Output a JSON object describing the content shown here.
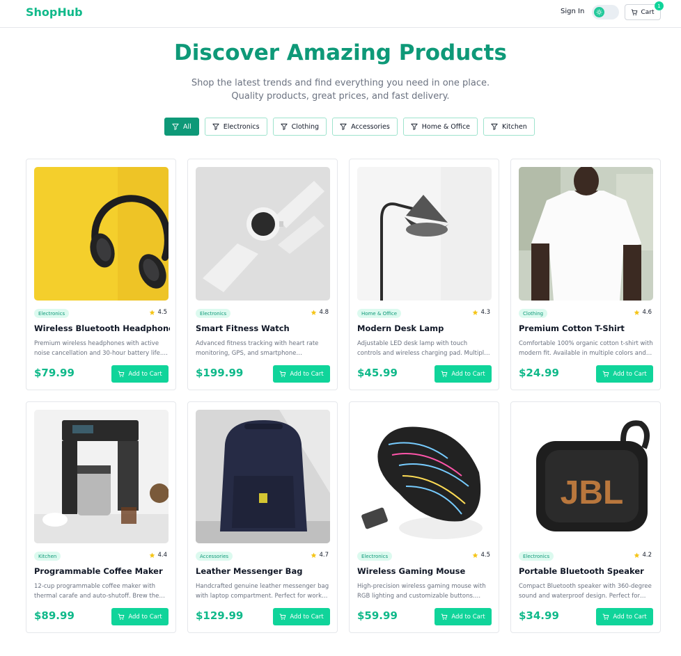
{
  "header": {
    "brand": "ShopHub",
    "sign_in": "Sign In",
    "cart_label": "Cart",
    "cart_count": "1"
  },
  "hero": {
    "title": "Discover Amazing Products",
    "subtitle": "Shop the latest trends and find everything you need in one place. Quality products, great prices, and fast delivery."
  },
  "filters": [
    {
      "label": "All",
      "active": true
    },
    {
      "label": "Electronics",
      "active": false
    },
    {
      "label": "Clothing",
      "active": false
    },
    {
      "label": "Accessories",
      "active": false
    },
    {
      "label": "Home & Office",
      "active": false
    },
    {
      "label": "Kitchen",
      "active": false
    }
  ],
  "button_label": "Add to Cart",
  "products": [
    {
      "name": "Wireless Bluetooth Headphones",
      "category": "Electronics",
      "rating": "4.5",
      "description": "Premium wireless headphones with active noise cancellation and 30-hour battery life. Perfect for music lovers.",
      "price": "$79.99",
      "image": "headphones"
    },
    {
      "name": "Smart Fitness Watch",
      "category": "Electronics",
      "rating": "4.8",
      "description": "Advanced fitness tracking with heart rate monitoring, GPS, and smartphone notifications.",
      "price": "$199.99",
      "image": "watch"
    },
    {
      "name": "Modern Desk Lamp",
      "category": "Home & Office",
      "rating": "4.3",
      "description": "Adjustable LED desk lamp with touch controls and wireless charging pad. Multiple brightness levels.",
      "price": "$45.99",
      "image": "lamp"
    },
    {
      "name": "Premium Cotton T-Shirt",
      "category": "Clothing",
      "rating": "4.6",
      "description": "Comfortable 100% organic cotton t-shirt with modern fit. Available in multiple colors and sizes.",
      "price": "$24.99",
      "image": "tshirt"
    },
    {
      "name": "Programmable Coffee Maker",
      "category": "Kitchen",
      "rating": "4.4",
      "description": "12-cup programmable coffee maker with thermal carafe and auto-shutoff. Brew the perfect cup every morning.",
      "price": "$89.99",
      "image": "coffee"
    },
    {
      "name": "Leather Messenger Bag",
      "category": "Accessories",
      "rating": "4.7",
      "description": "Handcrafted genuine leather messenger bag with laptop compartment. Perfect for work and travel.",
      "price": "$129.99",
      "image": "bag"
    },
    {
      "name": "Wireless Gaming Mouse",
      "category": "Electronics",
      "rating": "4.5",
      "description": "High-precision wireless gaming mouse with RGB lighting and customizable buttons. Ergonomic design.",
      "price": "$59.99",
      "image": "mouse"
    },
    {
      "name": "Portable Bluetooth Speaker",
      "category": "Electronics",
      "rating": "4.2",
      "description": "Compact Bluetooth speaker with 360-degree sound and waterproof design. Perfect for outdoor adventures.",
      "price": "$34.99",
      "image": "speaker"
    }
  ],
  "colors": {
    "brand": "#10b98a",
    "title": "#0e9978",
    "button": "#10d49a",
    "badge_bg": "#dcfaef",
    "star": "#f5c518"
  }
}
